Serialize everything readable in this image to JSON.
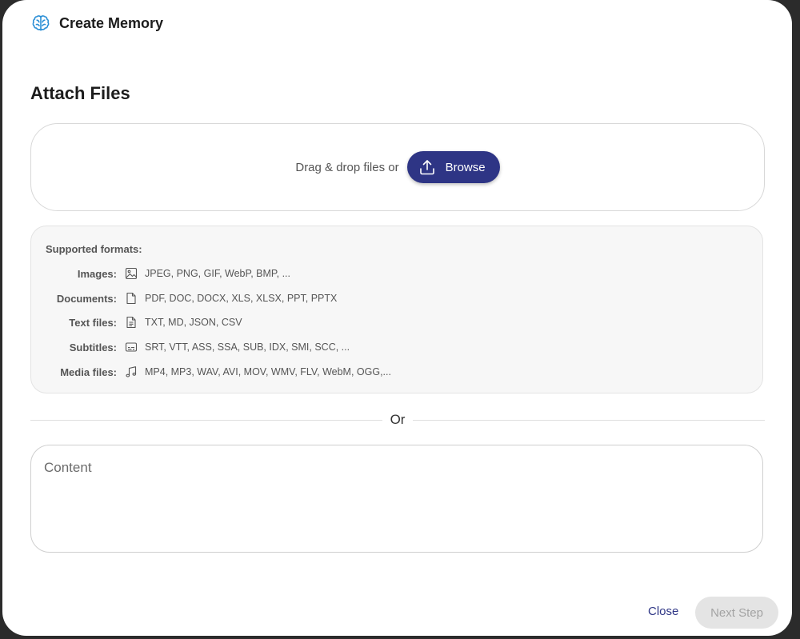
{
  "header": {
    "title": "Create Memory",
    "icon": "brain-icon",
    "accent": "#2b8fd6"
  },
  "attach": {
    "title": "Attach Files",
    "drop_text": "Drag & drop files or",
    "browse_label": "Browse",
    "browse_icon": "upload-icon",
    "brand_color": "#2e3585"
  },
  "formats": {
    "heading": "Supported formats:",
    "rows": [
      {
        "label": "Images:",
        "icon": "image-icon",
        "list": "JPEG, PNG, GIF, WebP, BMP, ..."
      },
      {
        "label": "Documents:",
        "icon": "document-icon",
        "list": "PDF, DOC, DOCX, XLS, XLSX, PPT, PPTX"
      },
      {
        "label": "Text files:",
        "icon": "text-file-icon",
        "list": "TXT, MD, JSON, CSV"
      },
      {
        "label": "Subtitles:",
        "icon": "subtitles-icon",
        "list": "SRT, VTT, ASS, SSA, SUB, IDX, SMI, SCC, ..."
      },
      {
        "label": "Media files:",
        "icon": "music-note-icon",
        "list": "MP4, MP3, WAV, AVI, MOV, WMV, FLV, WebM, OGG,..."
      }
    ]
  },
  "divider": {
    "text": "Or"
  },
  "content": {
    "placeholder": "Content",
    "value": ""
  },
  "footer": {
    "close_label": "Close",
    "next_label": "Next Step",
    "next_disabled": true
  }
}
